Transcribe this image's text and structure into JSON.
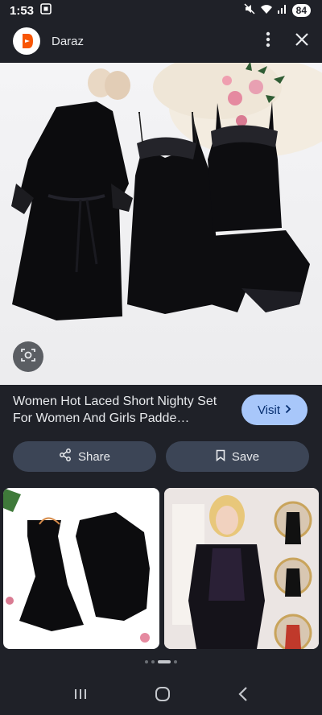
{
  "status": {
    "time": "1:53",
    "battery": "84"
  },
  "header": {
    "site_name": "Daraz"
  },
  "product": {
    "title": "Women Hot Laced Short Nighty Set For Women And Girls Padde…",
    "visit_label": "Visit"
  },
  "actions": {
    "share_label": "Share",
    "save_label": "Save"
  },
  "pagination": {
    "total": 4,
    "active": 2
  },
  "colors": {
    "background": "#1f2128",
    "visit_bg": "#a8c7fa",
    "action_bg": "#3c4556",
    "brand": "#f85606"
  }
}
